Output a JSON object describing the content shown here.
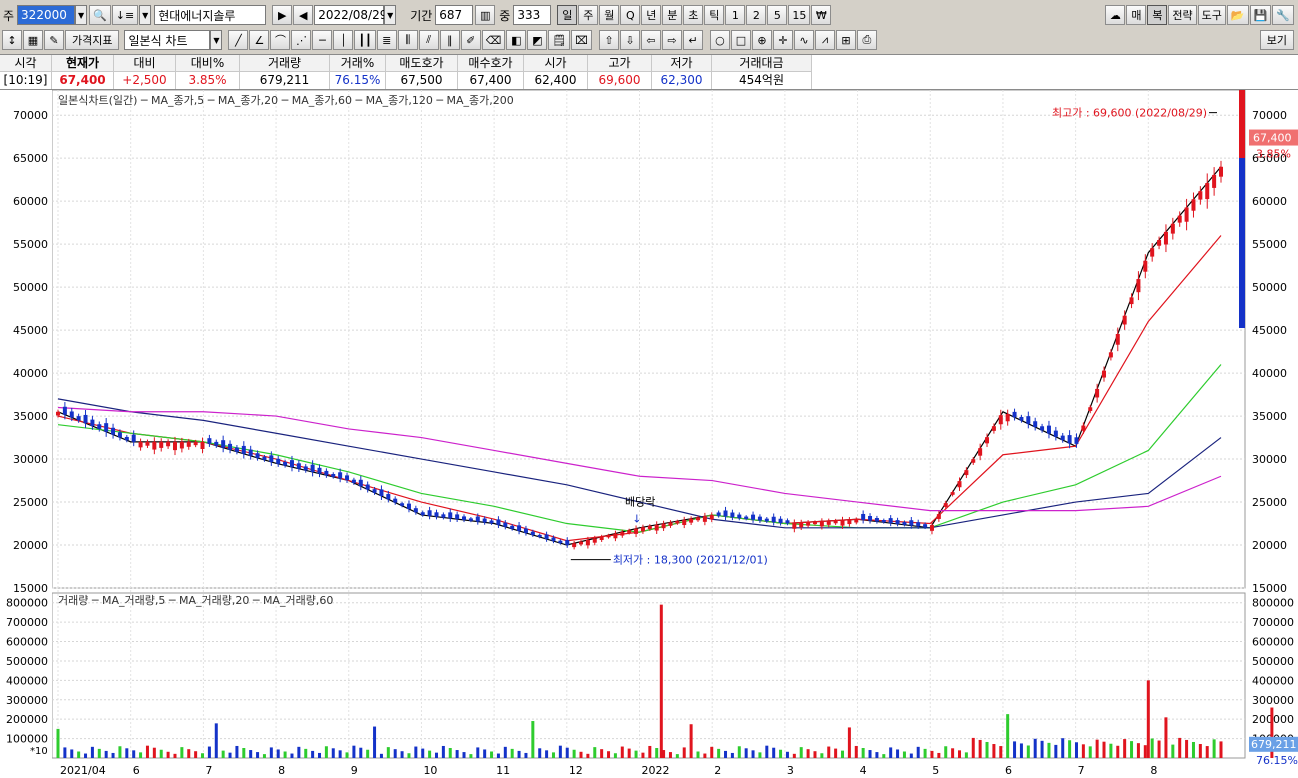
{
  "toolbar1": {
    "stock_type": "주",
    "code": "322000",
    "name": "현대에너지솔루",
    "date": "2022/08/29",
    "period_label": "기간",
    "period": "687",
    "count_label": "중",
    "count": "333",
    "period_buttons": [
      "일",
      "주",
      "월",
      "Q",
      "년",
      "분",
      "초",
      "틱",
      "1",
      "2",
      "5",
      "15",
      "₩"
    ],
    "right_buttons": [
      "매",
      "복",
      "전략",
      "도구"
    ]
  },
  "toolbar2": {
    "indicator_button": "가격지표",
    "chart_type": "일본식 차트",
    "view_button": "보기"
  },
  "quote": {
    "headers": [
      "시각",
      "현재가",
      "대비",
      "대비%",
      "거래량",
      "거래%",
      "매도호가",
      "매수호가",
      "시가",
      "고가",
      "저가",
      "거래대금"
    ],
    "values": [
      "[10:19]",
      "67,400",
      "+2,500",
      "3.85%",
      "679,211",
      "76.15%",
      "67,500",
      "67,400",
      "62,400",
      "69,600",
      "62,300",
      "454억원"
    ]
  },
  "price_panel": {
    "legend": [
      "일본식차트(일간)",
      "MA_종가,5",
      "MA_종가,20",
      "MA_종가,60",
      "MA_종가,120",
      "MA_종가,200"
    ],
    "y_ticks": [
      "70000",
      "65000",
      "60000",
      "55000",
      "50000",
      "45000",
      "40000",
      "35000",
      "30000",
      "25000",
      "20000",
      "15000"
    ],
    "high_note": "최고가 : 69,600 (2022/08/29)",
    "low_note": "최저가 : 18,300 (2021/12/01)",
    "dividend_note": "배당락",
    "current_price": "67,400",
    "current_change": "3.85%"
  },
  "volume_panel": {
    "legend": [
      "거래량",
      "MA_거래량,5",
      "MA_거래량,20",
      "MA_거래량,60"
    ],
    "y_ticks": [
      "800000",
      "700000",
      "600000",
      "500000",
      "400000",
      "300000",
      "200000",
      "100000"
    ],
    "scale_note": "*10",
    "current_volume": "679,211",
    "current_pct": "76.15%"
  },
  "x_axis": [
    "2021/04",
    "6",
    "7",
    "8",
    "9",
    "10",
    "11",
    "12",
    "2022",
    "2",
    "3",
    "4",
    "5",
    "6",
    "7",
    "8"
  ],
  "colors": {
    "up": "#e0141e",
    "down": "#1432c8",
    "ma5": "#000000",
    "ma20": "#e0141e",
    "ma60": "#2ecc2e",
    "ma120": "#1a237e",
    "ma200": "#cc22cc"
  },
  "chart_data": {
    "type": "line",
    "title": "일본식차트(일간)",
    "xlabel": "",
    "ylabel": "",
    "ylim": [
      15000,
      72000
    ],
    "x": [
      "2021/04",
      "2021/06",
      "2021/07",
      "2021/08",
      "2021/09",
      "2021/10",
      "2021/11",
      "2021/12",
      "2022/01",
      "2022/02",
      "2022/03",
      "2022/04",
      "2022/05",
      "2022/06",
      "2022/07",
      "2022/08",
      "2022/08/29"
    ],
    "series": [
      {
        "name": "MA_종가,5",
        "values": [
          35500,
          32000,
          32000,
          29500,
          27500,
          23500,
          22500,
          20000,
          22000,
          23500,
          22500,
          23000,
          22000,
          35500,
          31500,
          54000,
          64000
        ]
      },
      {
        "name": "MA_종가,20",
        "values": [
          35000,
          33000,
          32000,
          30000,
          27500,
          25000,
          23000,
          20500,
          21500,
          23500,
          22500,
          23000,
          22500,
          30500,
          31500,
          46000,
          56000
        ]
      },
      {
        "name": "MA_종가,60",
        "values": [
          34000,
          33000,
          32000,
          30500,
          28500,
          26000,
          24500,
          22500,
          21500,
          23500,
          22500,
          22000,
          22000,
          25000,
          27000,
          31000,
          41000
        ]
      },
      {
        "name": "MA_종가,120",
        "values": [
          37000,
          35500,
          34500,
          33000,
          31500,
          30000,
          28500,
          27000,
          25000,
          23000,
          22000,
          22000,
          22000,
          23500,
          25000,
          26000,
          32500
        ]
      },
      {
        "name": "MA_종가,200",
        "values": [
          36000,
          35500,
          35500,
          35000,
          33500,
          32500,
          31000,
          29500,
          28000,
          27500,
          26000,
          25000,
          24000,
          24000,
          24000,
          24500,
          28000
        ]
      }
    ]
  }
}
